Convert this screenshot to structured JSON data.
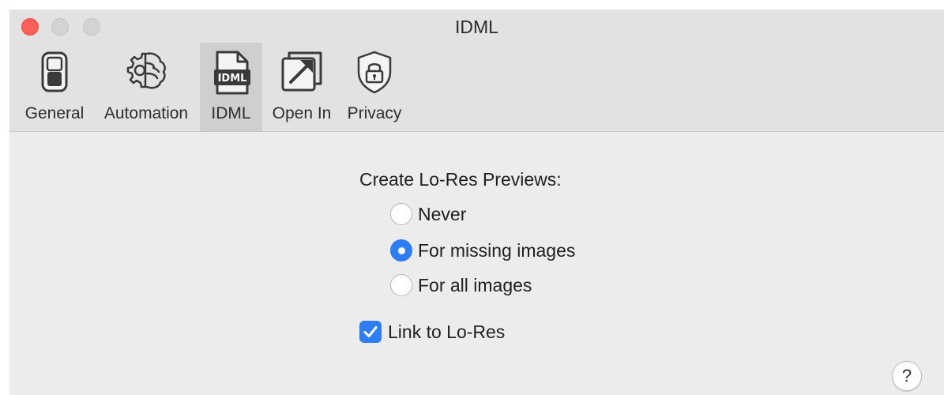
{
  "window": {
    "title": "IDML"
  },
  "toolbar": {
    "items": [
      {
        "label": "General",
        "icon": "toggle-switch-icon"
      },
      {
        "label": "Automation",
        "icon": "brain-gear-icon"
      },
      {
        "label": "IDML",
        "icon": "idml-document-icon",
        "selected": true
      },
      {
        "label": "Open In",
        "icon": "open-in-arrow-icon"
      },
      {
        "label": "Privacy",
        "icon": "shield-lock-icon"
      }
    ]
  },
  "previews": {
    "title": "Create Lo-Res Previews:",
    "options": [
      {
        "label": "Never",
        "checked": false
      },
      {
        "label": "For missing images",
        "checked": true
      },
      {
        "label": "For all images",
        "checked": false
      }
    ]
  },
  "link_option": {
    "label": "Link to Lo-Res",
    "checked": true
  },
  "help": {
    "label": "?"
  },
  "colors": {
    "accent": "#2c7df6",
    "close": "#ff5f57",
    "toolbar_bg": "#e2e2e2",
    "content_bg": "#ececec"
  }
}
